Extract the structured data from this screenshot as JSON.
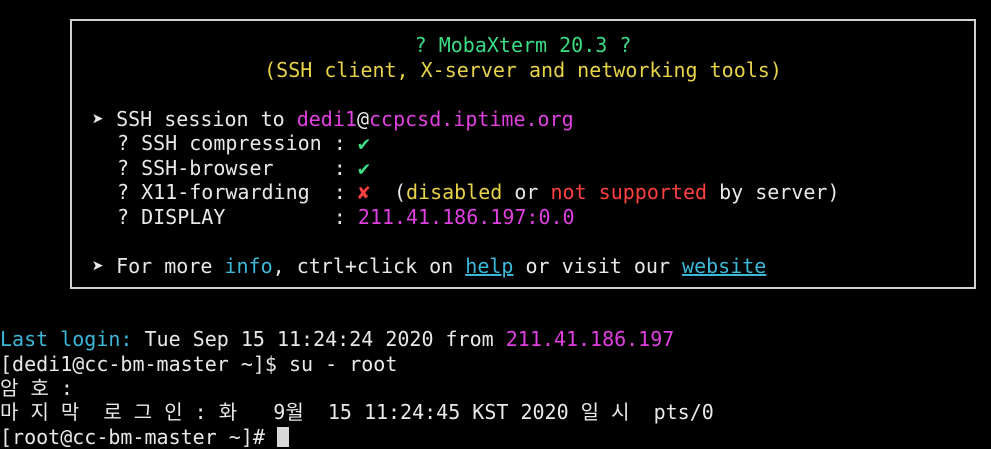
{
  "banner": {
    "title": "? MobaXterm 20.3 ?",
    "subtitle": "(SSH client, X-server and networking tools)",
    "session": {
      "bullet": "➤",
      "prefix": "SSH session to ",
      "user": "dedi1",
      "at": "@",
      "host": "ccpcsd.iptime.org"
    },
    "options": [
      {
        "label": "? SSH compression : ",
        "mark": "✔",
        "status": "ok"
      },
      {
        "label": "? SSH-browser     : ",
        "mark": "✔",
        "status": "ok"
      },
      {
        "label": "? X11-forwarding  : ",
        "mark": "✘",
        "status": "fail"
      }
    ],
    "x11_note": {
      "open": "  (",
      "disabled": "disabled",
      "or": " or ",
      "not_supported": "not supported",
      "by_server": " by server)"
    },
    "display": {
      "label": "? DISPLAY         : ",
      "value": "211.41.186.197:0.0"
    },
    "footer": {
      "bullet": "➤",
      "text1": "For more ",
      "info": "info",
      "text2": ", ctrl+click on ",
      "help": "help",
      "text3": " or visit our ",
      "website": "website"
    }
  },
  "terminal": {
    "last_login_label": "Last login:",
    "last_login_text": " Tue Sep 15 11:24:24 2020 from ",
    "last_login_ip": "211.41.186.197",
    "prompt1": "[dedi1@cc-bm-master ~]$ su - root",
    "password_prompt": "암 호 :",
    "last_login_kr": "마 지 막  로 그 인 : 화   9월  15 11:24:45 KST 2020 일 시  pts/0",
    "prompt2": "[root@cc-bm-master ~]# "
  }
}
